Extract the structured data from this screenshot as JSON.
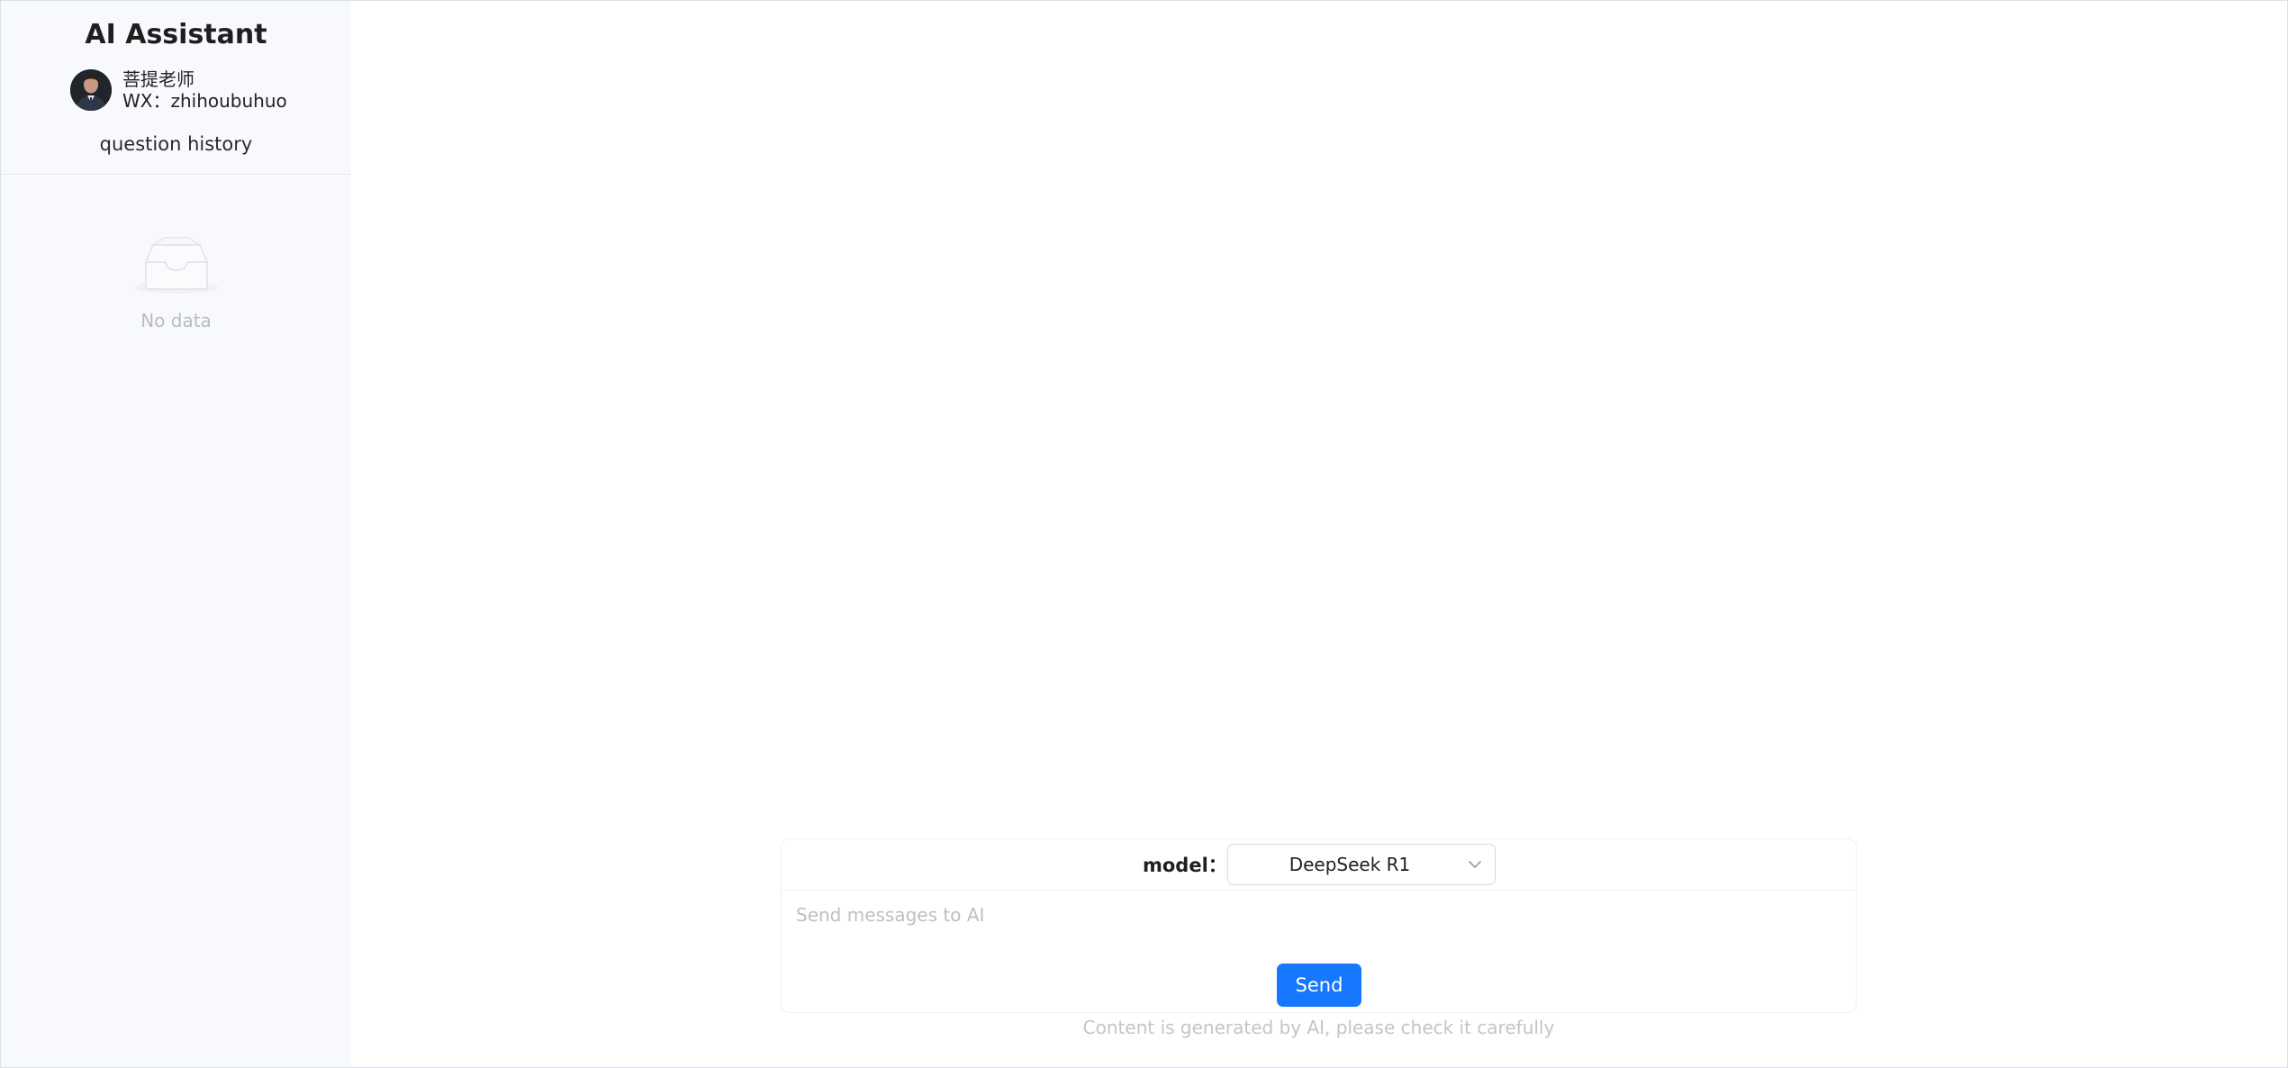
{
  "sidebar": {
    "title": "AI Assistant",
    "profile": {
      "name": "菩提老师",
      "wx": "WX：zhihoubuhuo"
    },
    "history_label": "question history",
    "empty_text": "No data"
  },
  "composer": {
    "model_label": "model：",
    "model_value": "DeepSeek R1",
    "input_placeholder": "Send messages to AI",
    "send_label": "Send"
  },
  "footer": {
    "disclaimer": "Content is generated by AI, please check it carefully"
  },
  "colors": {
    "accent": "#1677ff",
    "sidebar_bg": "#f8f9fd"
  },
  "icons": {
    "avatar": "avatar",
    "empty": "inbox-empty-icon",
    "select": "chevron-down-icon"
  }
}
